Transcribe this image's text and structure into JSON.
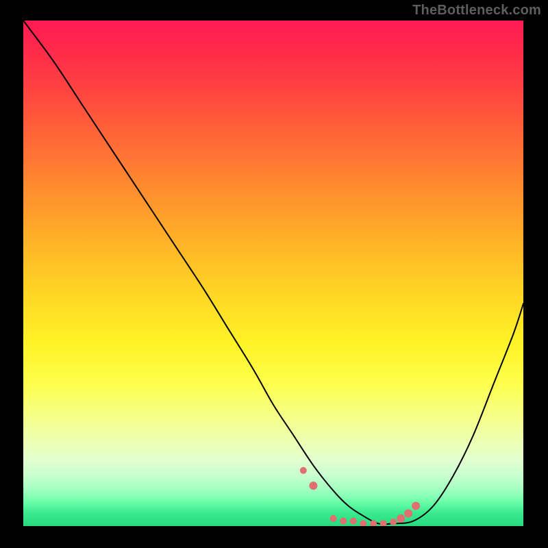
{
  "watermark": {
    "text": "TheBottleneck.com"
  },
  "colors": {
    "background": "#000000",
    "curve": "#000000",
    "marker": "#e07070",
    "gradient_top": "#ff1a52",
    "gradient_bottom": "#28d97f"
  },
  "chart_data": {
    "type": "line",
    "title": "",
    "xlabel": "",
    "ylabel": "",
    "xlim": [
      0,
      100
    ],
    "ylim": [
      0,
      100
    ],
    "note": "Axes have no visible tick labels; x runs left→right 0–100, y is bottleneck % with 0 at bottom and 100 at top.",
    "series": [
      {
        "name": "bottleneck-curve",
        "x": [
          0,
          6,
          12,
          18,
          24,
          30,
          36,
          41,
          46,
          50,
          54,
          58,
          62,
          65,
          68,
          71,
          74,
          78,
          82,
          86,
          90,
          94,
          98,
          100
        ],
        "y": [
          100,
          92,
          83,
          74,
          65,
          56,
          47,
          39,
          31,
          24,
          18,
          12,
          7,
          4,
          2,
          0.5,
          0.5,
          1,
          4,
          10,
          18,
          28,
          38,
          44
        ]
      }
    ],
    "markers": {
      "name": "highlighted-points",
      "x": [
        56,
        58,
        62,
        64,
        66,
        68,
        70,
        72,
        74,
        75.5,
        77,
        78.5
      ],
      "y": [
        11,
        8,
        1.5,
        1,
        1,
        0.5,
        0.5,
        0.5,
        0.8,
        1.5,
        2.5,
        4
      ],
      "r": [
        5,
        6,
        5,
        5,
        5,
        5,
        5,
        5,
        5,
        6,
        6,
        6
      ]
    },
    "background_field": {
      "description": "Vertical gradient mapping y (bottleneck %) to color: high=red, mid=yellow, low=green."
    }
  }
}
